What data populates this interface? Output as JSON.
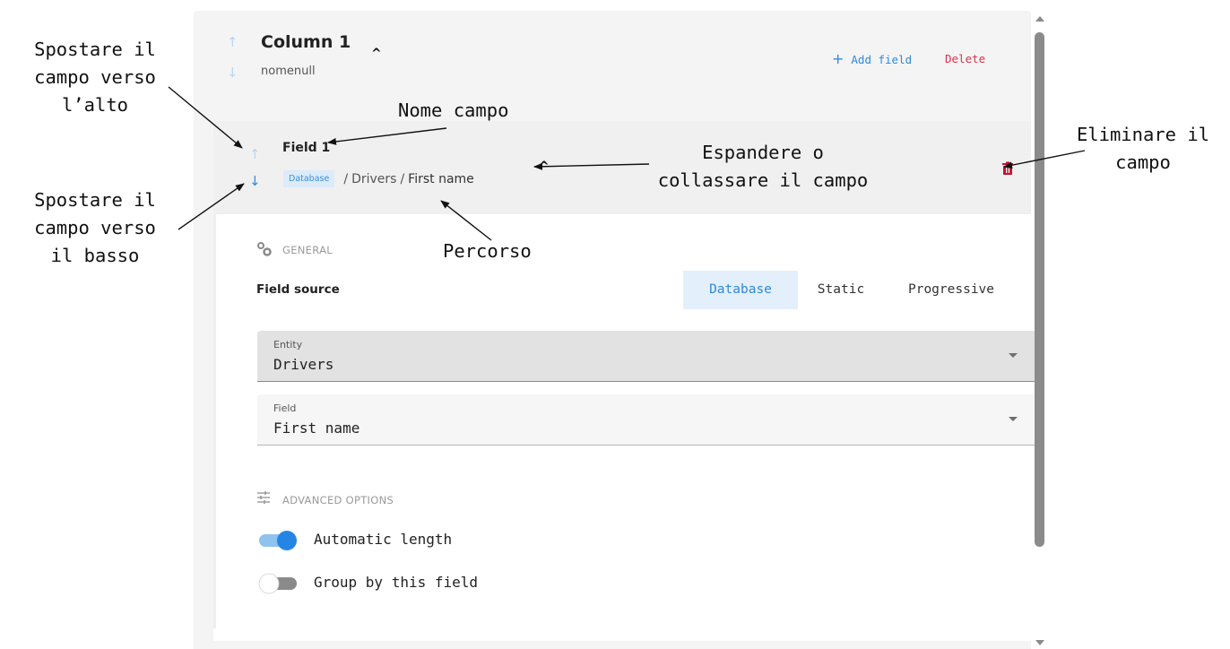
{
  "column": {
    "title": "Column 1",
    "subtitle": "nomenull",
    "add_field_label": "Add field",
    "delete_label": "Delete"
  },
  "field": {
    "title": "Field 1",
    "path_chip": "Database",
    "path_entity": "Drivers",
    "path_field": "First name",
    "general_label": "GENERAL",
    "source_label": "Field source",
    "tabs": [
      {
        "label": "Database",
        "active": true
      },
      {
        "label": "Static",
        "active": false
      },
      {
        "label": "Progressive",
        "active": false
      }
    ],
    "entity_select": {
      "label": "Entity",
      "value": "Drivers"
    },
    "field_select": {
      "label": "Field",
      "value": "First name"
    },
    "advanced_label": "ADVANCED OPTIONS",
    "toggles": [
      {
        "label": "Automatic length",
        "on": true
      },
      {
        "label": "Group by this field",
        "on": false
      }
    ]
  },
  "annotations": {
    "move_up": [
      "Spostare il",
      "campo verso",
      "l’alto"
    ],
    "move_down": [
      "Spostare il",
      "campo verso",
      "il basso"
    ],
    "field_name": "Nome campo",
    "expand": [
      "Espandere o",
      "collassare il campo"
    ],
    "path": "Percorso",
    "delete_field": [
      "Eliminare il",
      "campo"
    ]
  },
  "colors": {
    "accent": "#2f88e0",
    "danger": "#d9344a",
    "panel_bg": "#f4f4f4"
  },
  "icons": [
    "arrow-up-icon",
    "arrow-down-icon",
    "chevron-up-icon",
    "plus-icon",
    "trash-icon",
    "gear-icon",
    "tune-icon"
  ]
}
